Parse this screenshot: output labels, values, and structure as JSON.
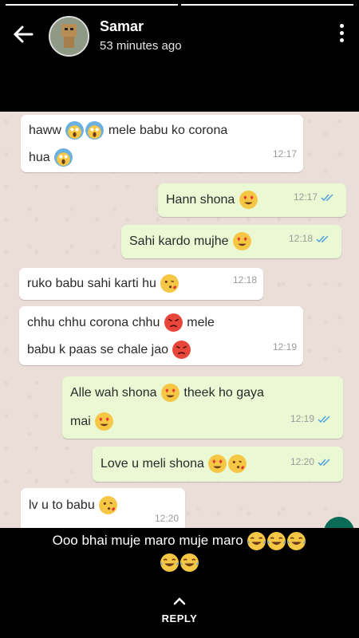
{
  "status": {
    "progress_segments": 2,
    "active_segment": 1
  },
  "header": {
    "name": "Samar",
    "time": "53 minutes ago",
    "back_icon": "arrow-back-icon",
    "menu_icon": "more-vert-icon"
  },
  "chat": {
    "messages": [
      {
        "dir": "in",
        "line1": "haww",
        "line1b": "mele babu ko corona",
        "line2": "hua",
        "time": "12:17"
      },
      {
        "dir": "out",
        "text": "Hann shona",
        "time": "12:17"
      },
      {
        "dir": "out",
        "text": "Sahi kardo mujhe",
        "time": "12:18"
      },
      {
        "dir": "in",
        "text": "ruko babu sahi karti hu",
        "time": "12:18"
      },
      {
        "dir": "in",
        "line1": "chhu chhu corona chhu",
        "line1b": "mele",
        "line2": "babu k paas se chale jao",
        "time": "12:19"
      },
      {
        "dir": "out",
        "line1": "Alle wah shona",
        "line1b": "theek ho gaya",
        "line2": "mai",
        "time": "12:19"
      },
      {
        "dir": "out",
        "text": "Love u meli shona",
        "time": "12:20"
      },
      {
        "dir": "in",
        "text": "lv u to babu",
        "time": "12:20"
      }
    ]
  },
  "caption": {
    "text": "Ooo bhai muje maro muje maro"
  },
  "reply": {
    "label": "REPLY",
    "icon": "chevron-up-icon"
  },
  "colors": {
    "background": "#000000",
    "bubble_in": "#ffffff",
    "bubble_out": "#eaf8d4",
    "tick": "#4fa3e0"
  }
}
